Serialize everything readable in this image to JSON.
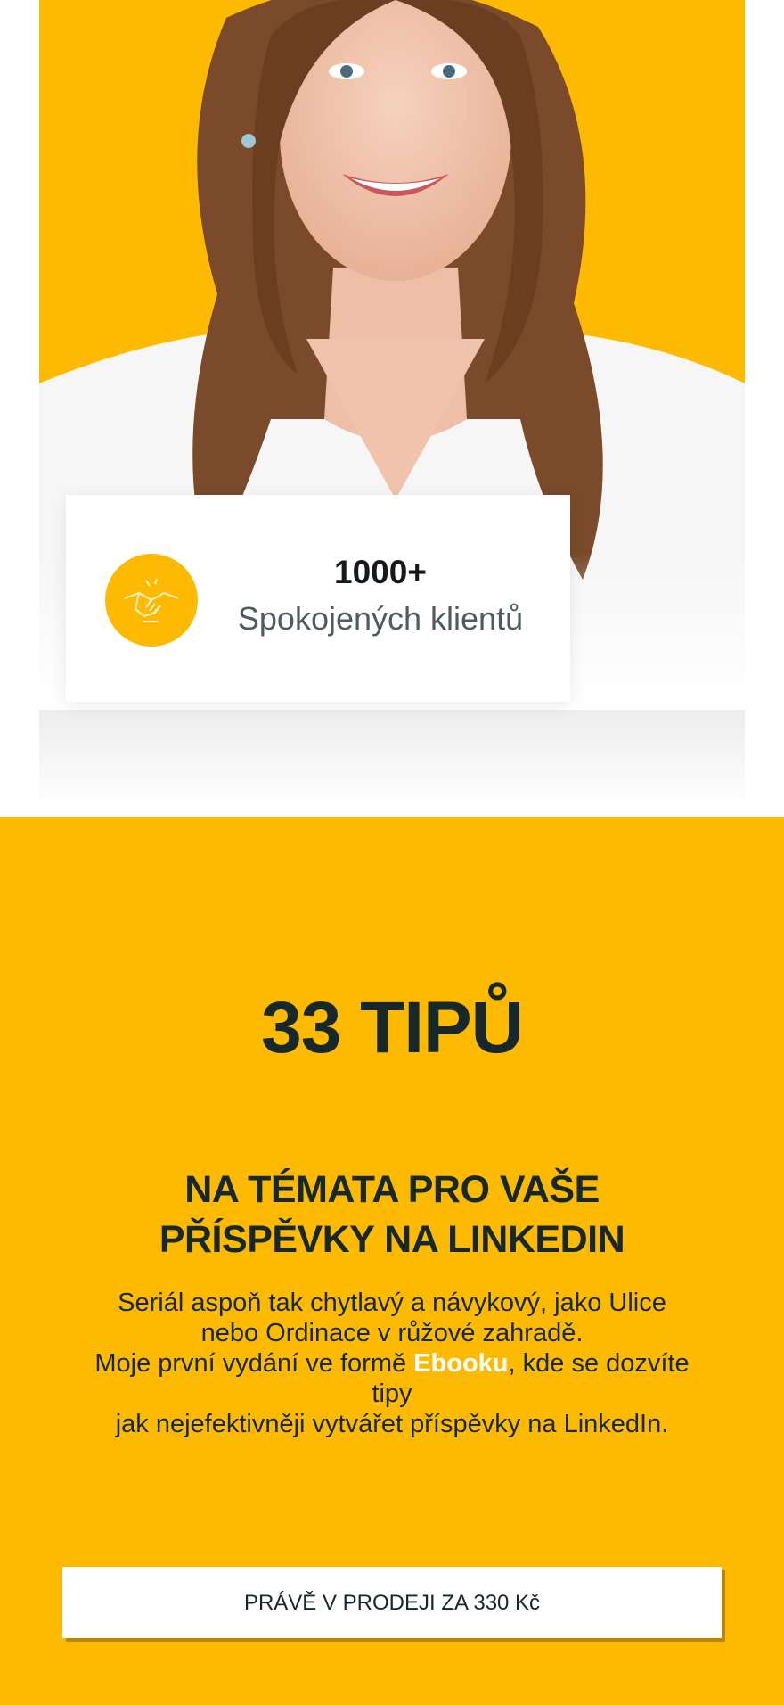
{
  "hero": {
    "photo": "portrait-of-smiling-woman",
    "background_color": "#FDBA00"
  },
  "stats": {
    "icon": "handshake-icon",
    "number": "1000+",
    "label": "Spokojených klientů"
  },
  "promo": {
    "background_color": "#FDBA00",
    "title": "33 TIPŮ",
    "subtitle_line1": "NA TÉMATA PRO VAŠE",
    "subtitle_line2": "PŘÍSPĚVKY NA LINKEDIN",
    "text_line1": "Seriál aspoň tak chytlavý a návykový, jako Ulice",
    "text_line2": "nebo Ordinace v růžové zahradě.",
    "text_line3_before": "Moje první vydání ve formě ",
    "text_line3_highlight": "Ebooku",
    "text_line3_after": ", kde se dozvíte",
    "text_line4": "tipy",
    "text_line5": "jak nejefektivněji vytvářet příspěvky na LinkedIn.",
    "cta_label": "PRÁVĚ V PRODEJI ZA 330 Kč"
  }
}
